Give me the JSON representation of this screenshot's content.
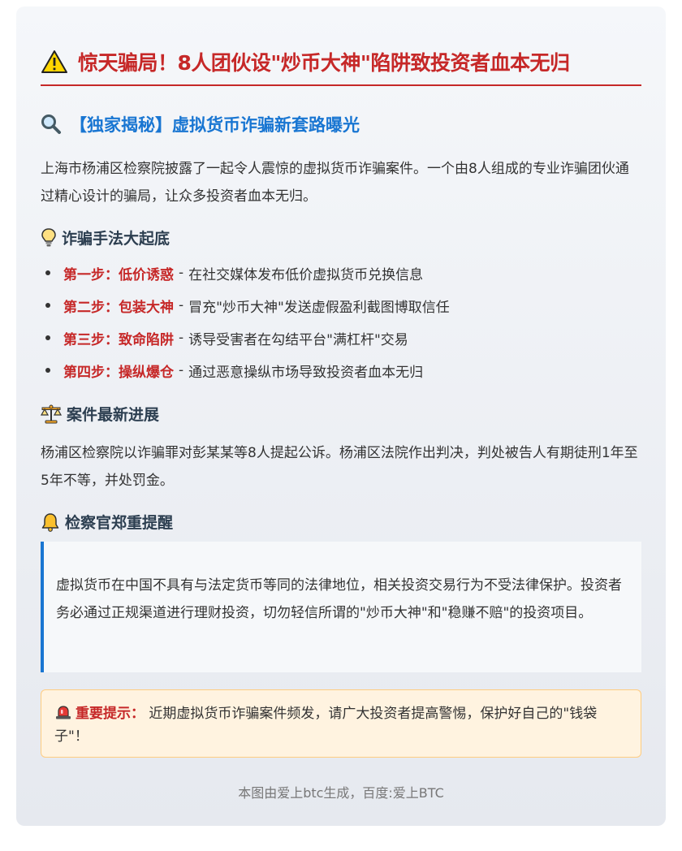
{
  "title": {
    "icon": "warning-icon",
    "text": "惊天骗局！8人团伙设\"炒币大神\"陷阱致投资者血本无归",
    "color": "#c62828"
  },
  "subtitle": {
    "icon": "magnifier-icon",
    "text": "【独家揭秘】虚拟货币诈骗新套路曝光",
    "color": "#1976d2"
  },
  "intro": "上海市杨浦区检察院披露了一起令人震惊的虚拟货币诈骗案件。一个由8人组成的专业诈骗团伙通过精心设计的骗局，让众多投资者血本无归。",
  "methods": {
    "icon": "lightbulb-icon",
    "heading": "诈骗手法大起底",
    "separator": "-",
    "steps": [
      {
        "label": "第一步：低价诱惑",
        "desc": "在社交媒体发布低价虚拟货币兑换信息"
      },
      {
        "label": "第二步：包装大神",
        "desc": "冒充\"炒币大神\"发送虚假盈利截图博取信任"
      },
      {
        "label": "第三步：致命陷阱",
        "desc": "诱导受害者在勾结平台\"满杠杆\"交易"
      },
      {
        "label": "第四步：操纵爆仓",
        "desc": "通过恶意操纵市场导致投资者血本无归"
      }
    ]
  },
  "progress": {
    "icon": "scales-icon",
    "heading": "案件最新进展",
    "text": "杨浦区检察院以诈骗罪对彭某某等8人提起公诉。杨浦区法院作出判决，判处被告人有期徒刑1年至5年不等，并处罚金。"
  },
  "reminder": {
    "icon": "bell-icon",
    "heading": "检察官郑重提醒",
    "quote": "虚拟货币在中国不具有与法定货币等同的法律地位，相关投资交易行为不受法律保护。投资者务必通过正规渠道进行理财投资，切勿轻信所谓的\"炒币大神\"和\"稳赚不赔\"的投资项目。"
  },
  "notice": {
    "icon": "siren-icon",
    "label": "重要提示：",
    "text": "近期虚拟货币诈骗案件频发，请广大投资者提高警惕，保护好自己的\"钱袋子\"！"
  },
  "footer": "本图由爱上btc生成，百度:爱上BTC"
}
